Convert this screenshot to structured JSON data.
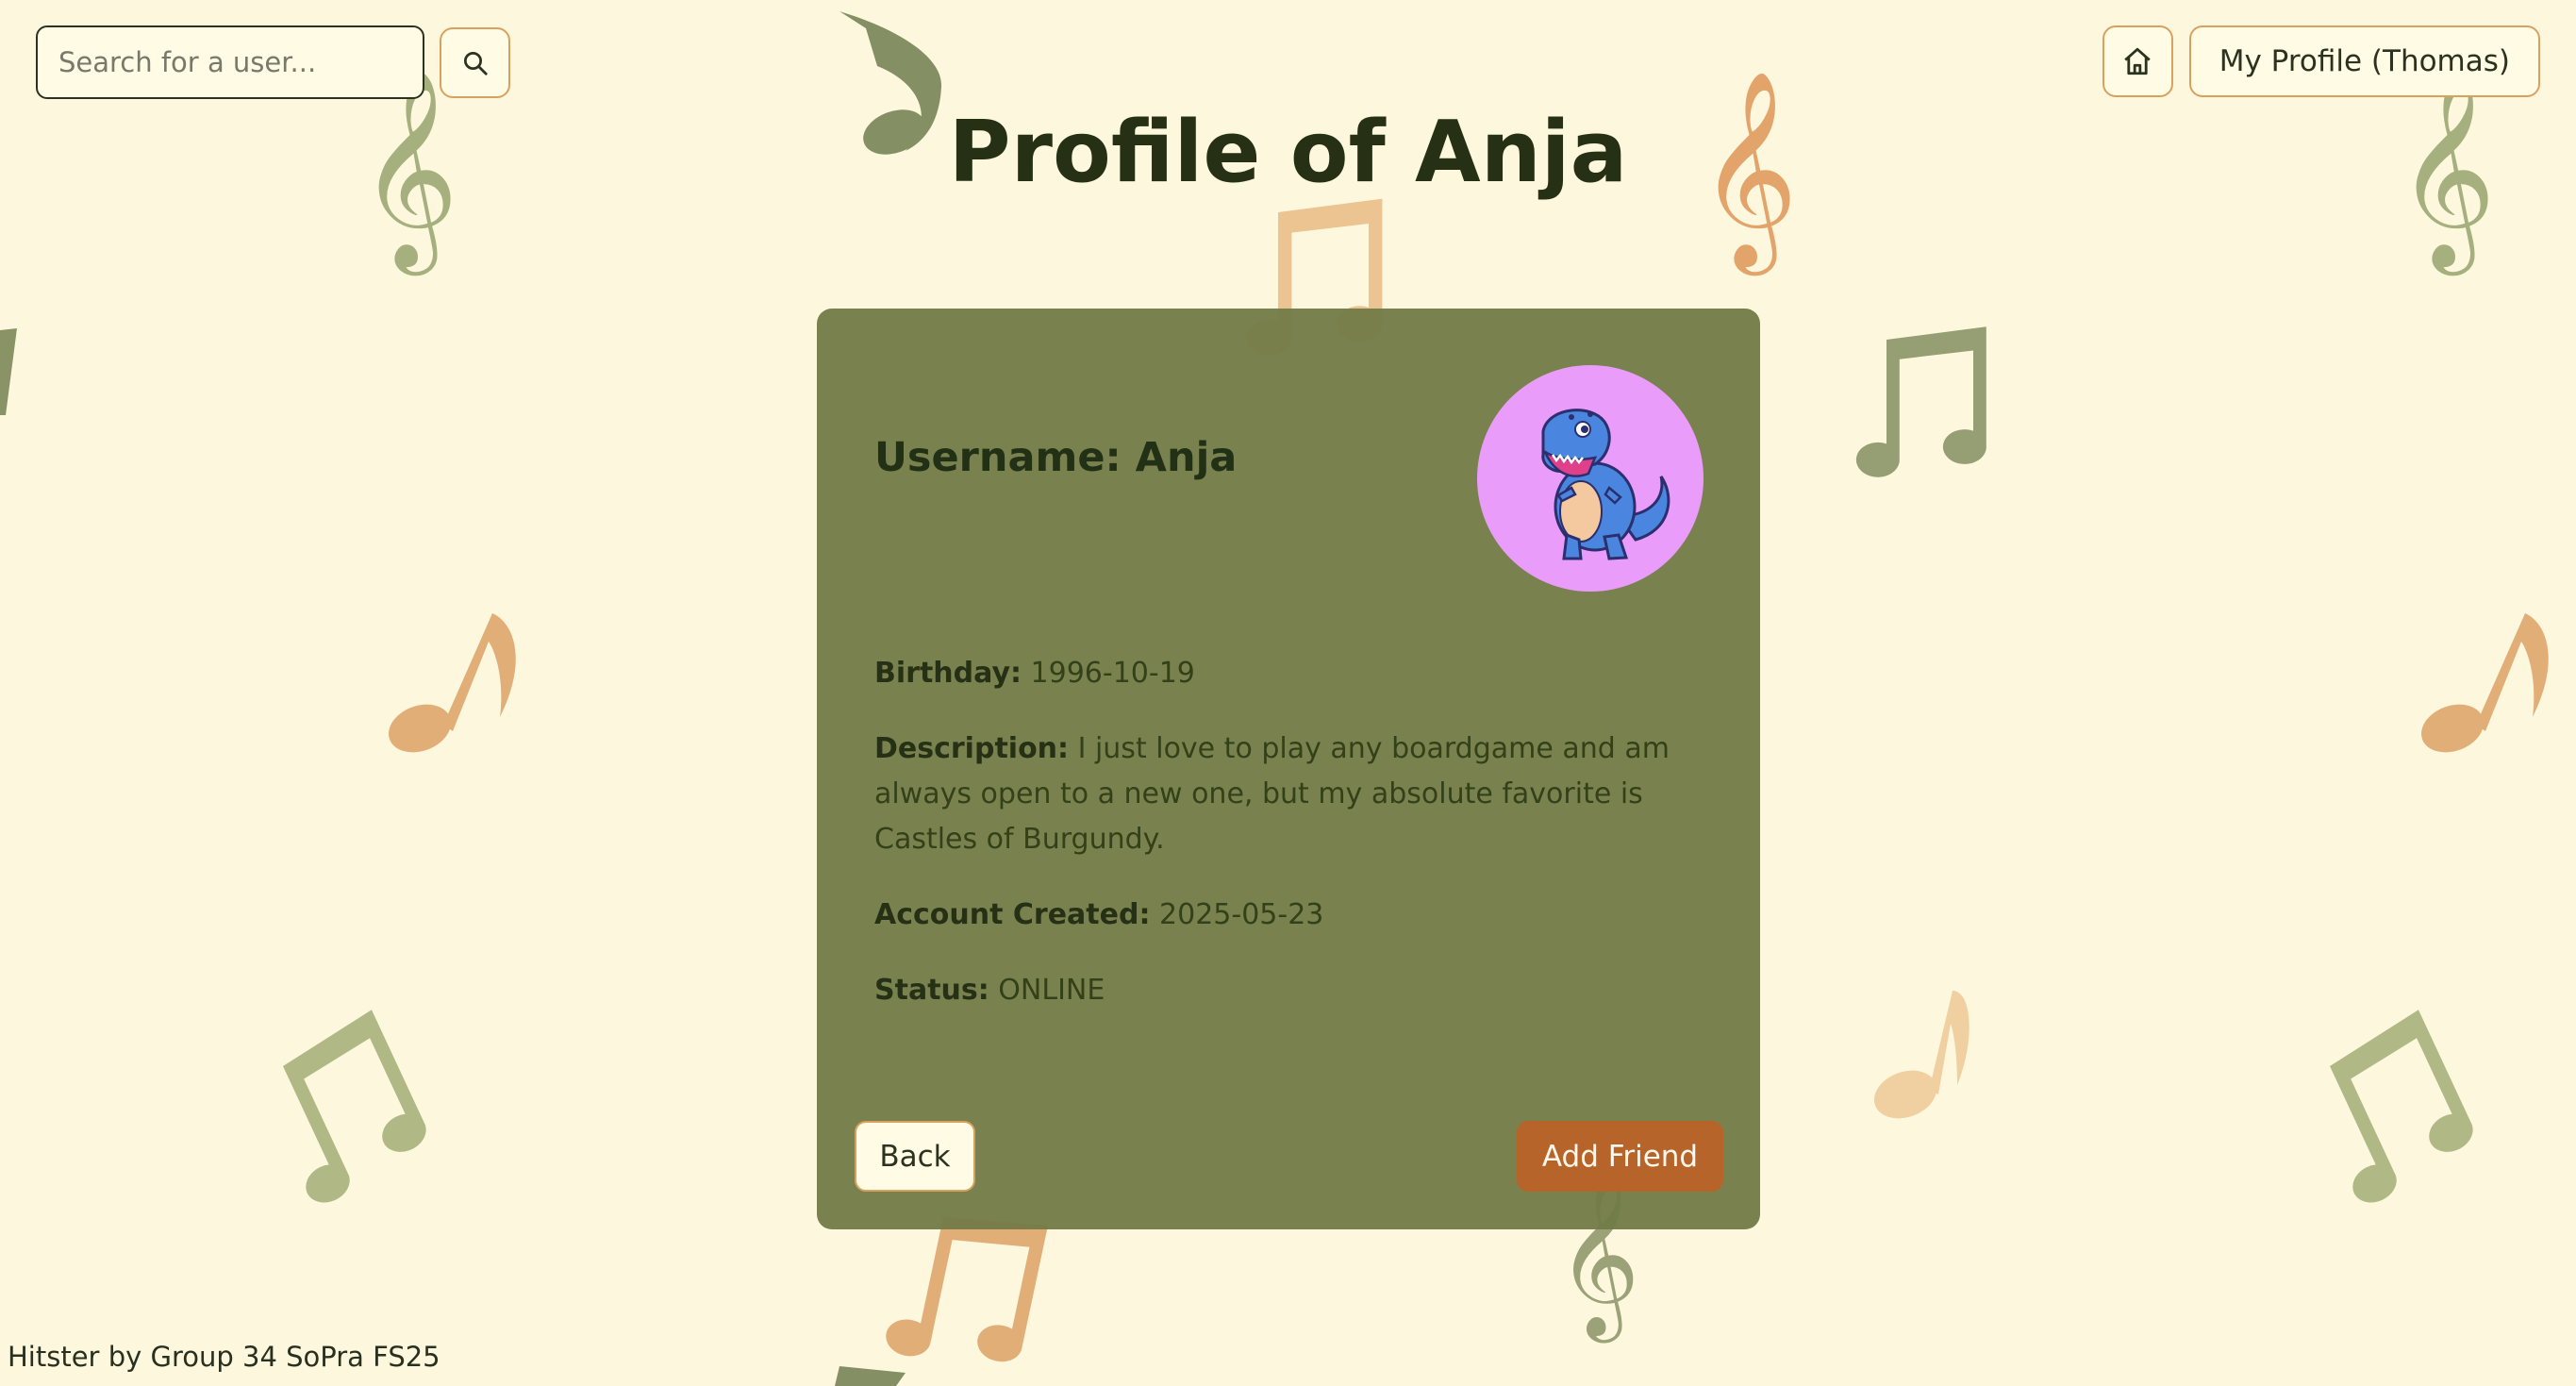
{
  "search": {
    "placeholder": "Search for a user..."
  },
  "header": {
    "my_profile_label": "My Profile (Thomas)",
    "page_title": "Profile of Anja"
  },
  "profile": {
    "username_label": "Username:",
    "username": "Anja",
    "birthday_label": "Birthday:",
    "birthday": "1996-10-19",
    "description_label": "Description:",
    "description": "I just love to play any boardgame and am always open to a new one, but my absolute favorite is Castles of Burgundy.",
    "account_created_label": "Account Created:",
    "account_created": "2025-05-23",
    "status_label": "Status:",
    "status": "ONLINE",
    "avatar": "blue-trex-dinosaur"
  },
  "actions": {
    "back_label": "Back",
    "add_friend_label": "Add Friend"
  },
  "footer": {
    "text": "Hitster by Group 34 SoPra FS25"
  },
  "colors": {
    "page_background": "#fdf8dd",
    "card_background": "#78804f",
    "accent_orange": "#b6642a",
    "button_border": "#d9a15f",
    "text_dark": "#263015",
    "avatar_background": "#e99cf9"
  },
  "icons": {
    "search": "search-icon",
    "home": "home-icon"
  }
}
